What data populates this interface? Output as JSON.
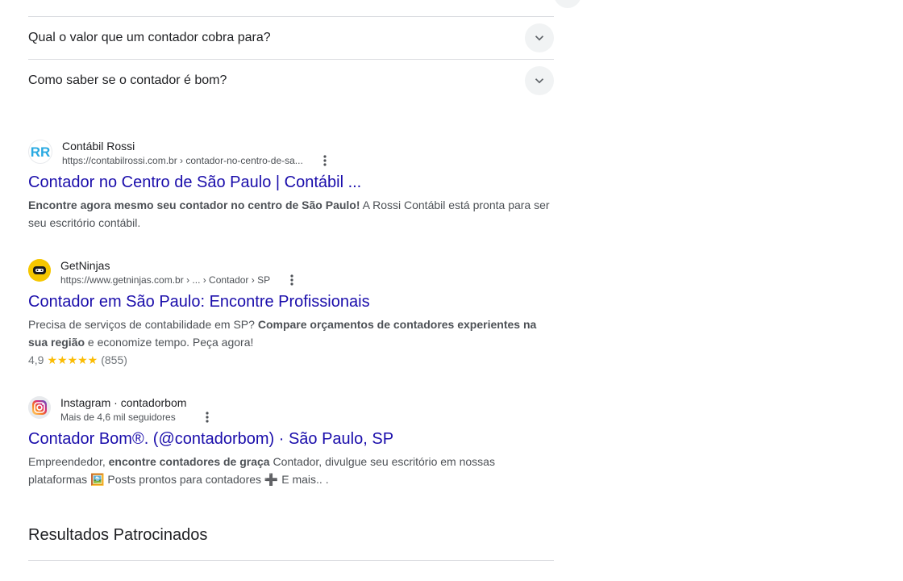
{
  "paa": {
    "questions": [
      "Qual o valor que um contador cobra para?",
      "Como saber se o contador é bom?"
    ]
  },
  "results": [
    {
      "site_name": "Contábil Rossi",
      "url": "https://contabilrossi.com.br › contador-no-centro-de-sa...",
      "title": "Contador no Centro de São Paulo | Contábil ...",
      "snippet_bold": "Encontre agora mesmo seu contador no centro de São Paulo!",
      "snippet_rest": " A Rossi Contábil está pronta para ser seu escritório contábil.",
      "favicon_icon": "rossi-logo"
    },
    {
      "site_name": "GetNinjas",
      "url": "https://www.getninjas.com.br › ... › Contador › SP",
      "title": "Contador em São Paulo: Encontre Profissionais",
      "snippet_pre": "Precisa de serviços de contabilidade em SP? ",
      "snippet_bold": "Compare orçamentos de contadores experientes na sua região",
      "snippet_post": " e economize tempo. Peça agora!",
      "rating": "4,9",
      "stars": "★★★★★",
      "reviews": "(855)",
      "favicon_icon": "ninja-logo"
    },
    {
      "site_name": "Instagram · contadorbom",
      "url": "Mais de 4,6 mil seguidores",
      "title": "Contador Bom®. (@contadorbom) · São Paulo, SP",
      "snippet_pre": "Empreendedor, ",
      "snippet_bold": "encontre contadores de graça",
      "snippet_post": " Contador, divulgue seu escritório em nossas plataformas 🖼️ Posts prontos para contadores ➕ E mais.. .",
      "favicon_icon": "instagram-logo"
    }
  ],
  "sponsored": {
    "title": "Resultados Patrocinados"
  },
  "colors": {
    "link": "#1a0dab",
    "text": "#202124",
    "muted": "#4d5156",
    "star": "#fbbc04"
  }
}
